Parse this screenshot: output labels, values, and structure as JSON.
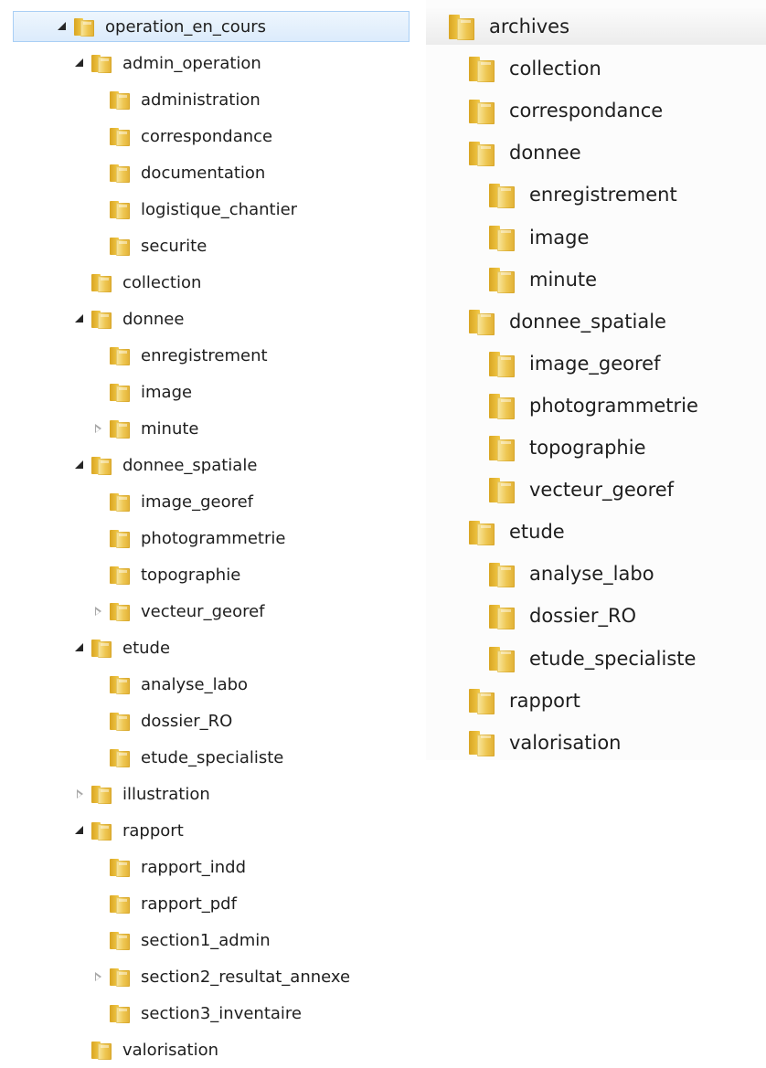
{
  "left_tree": [
    {
      "label": "operation_en_cours",
      "depth": 0,
      "arrow": "expanded",
      "selected": true
    },
    {
      "label": "admin_operation",
      "depth": 1,
      "arrow": "expanded"
    },
    {
      "label": "administration",
      "depth": 2,
      "arrow": "none"
    },
    {
      "label": "correspondance",
      "depth": 2,
      "arrow": "none"
    },
    {
      "label": "documentation",
      "depth": 2,
      "arrow": "none"
    },
    {
      "label": "logistique_chantier",
      "depth": 2,
      "arrow": "none"
    },
    {
      "label": "securite",
      "depth": 2,
      "arrow": "none"
    },
    {
      "label": "collection",
      "depth": 1,
      "arrow": "none"
    },
    {
      "label": "donnee",
      "depth": 1,
      "arrow": "expanded"
    },
    {
      "label": "enregistrement",
      "depth": 2,
      "arrow": "none"
    },
    {
      "label": "image",
      "depth": 2,
      "arrow": "none"
    },
    {
      "label": "minute",
      "depth": 2,
      "arrow": "collapsed"
    },
    {
      "label": "donnee_spatiale",
      "depth": 1,
      "arrow": "expanded"
    },
    {
      "label": "image_georef",
      "depth": 2,
      "arrow": "none"
    },
    {
      "label": "photogrammetrie",
      "depth": 2,
      "arrow": "none"
    },
    {
      "label": "topographie",
      "depth": 2,
      "arrow": "none"
    },
    {
      "label": "vecteur_georef",
      "depth": 2,
      "arrow": "collapsed"
    },
    {
      "label": "etude",
      "depth": 1,
      "arrow": "expanded"
    },
    {
      "label": "analyse_labo",
      "depth": 2,
      "arrow": "none"
    },
    {
      "label": "dossier_RO",
      "depth": 2,
      "arrow": "none"
    },
    {
      "label": "etude_specialiste",
      "depth": 2,
      "arrow": "none"
    },
    {
      "label": "illustration",
      "depth": 1,
      "arrow": "collapsed"
    },
    {
      "label": "rapport",
      "depth": 1,
      "arrow": "expanded"
    },
    {
      "label": "rapport_indd",
      "depth": 2,
      "arrow": "none"
    },
    {
      "label": "rapport_pdf",
      "depth": 2,
      "arrow": "none"
    },
    {
      "label": "section1_admin",
      "depth": 2,
      "arrow": "none"
    },
    {
      "label": "section2_resultat_annexe",
      "depth": 2,
      "arrow": "collapsed"
    },
    {
      "label": "section3_inventaire",
      "depth": 2,
      "arrow": "none"
    },
    {
      "label": "valorisation",
      "depth": 1,
      "arrow": "none"
    }
  ],
  "right_tree": [
    {
      "label": "archives",
      "depth": 0,
      "header": true
    },
    {
      "label": "collection",
      "depth": 1
    },
    {
      "label": "correspondance",
      "depth": 1
    },
    {
      "label": "donnee",
      "depth": 1
    },
    {
      "label": "enregistrement",
      "depth": 2
    },
    {
      "label": "image",
      "depth": 2
    },
    {
      "label": "minute",
      "depth": 2
    },
    {
      "label": "donnee_spatiale",
      "depth": 1
    },
    {
      "label": "image_georef",
      "depth": 2
    },
    {
      "label": "photogrammetrie",
      "depth": 2
    },
    {
      "label": "topographie",
      "depth": 2
    },
    {
      "label": "vecteur_georef",
      "depth": 2
    },
    {
      "label": "etude",
      "depth": 1
    },
    {
      "label": "analyse_labo",
      "depth": 2
    },
    {
      "label": "dossier_RO",
      "depth": 2
    },
    {
      "label": "etude_specialiste",
      "depth": 2
    },
    {
      "label": "rapport",
      "depth": 1
    },
    {
      "label": "valorisation",
      "depth": 1
    }
  ],
  "colors": {
    "selection_fill": "#dcebfc",
    "selection_border": "#a9cff5",
    "folder_yellow": "#eec651",
    "text": "#1e1e1e"
  },
  "icons": {
    "folder": "folder-icon",
    "expanded": "expanded-arrow-icon",
    "collapsed": "collapsed-arrow-icon"
  }
}
